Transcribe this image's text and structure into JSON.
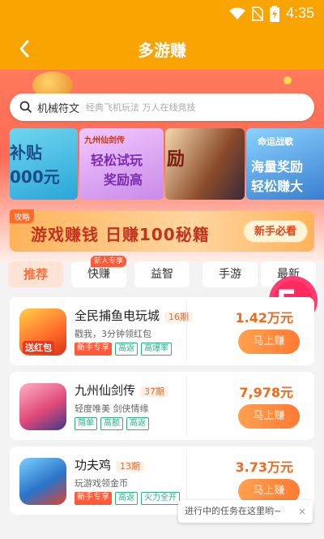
{
  "status": {
    "time": "4:35"
  },
  "header": {
    "title": "多游赚"
  },
  "search": {
    "value": "机械符文",
    "placeholder": "经典飞机玩法 万人在线竞技"
  },
  "banners": [
    {
      "lines": [
        "补贴",
        "000元"
      ]
    },
    {
      "logo": "九州仙剑传",
      "lines": [
        "轻松试玩",
        "奖励高"
      ]
    },
    {
      "lines": [
        "励"
      ]
    },
    {
      "logo": "命运战歌",
      "lines": [
        "海量奖励",
        "轻松赚大"
      ]
    }
  ],
  "promo": {
    "tag": "攻略",
    "title": "游戏赚钱 日赚100秘籍",
    "button": "新手必看"
  },
  "tabs": [
    {
      "label": "推荐",
      "active": true
    },
    {
      "label": "快赚",
      "badge": "新人专享"
    },
    {
      "label": "益智"
    },
    {
      "label": "手游"
    },
    {
      "label": "最新"
    }
  ],
  "float_badge": {
    "text": "5",
    "unit": "元"
  },
  "games": [
    {
      "name": "全民捕鱼电玩城",
      "period": "16期",
      "desc": "戳我，3分钟领红包",
      "tags": [
        {
          "text": "新手专享",
          "style": "red"
        },
        {
          "text": "高返",
          "style": "green"
        },
        {
          "text": "高爆率",
          "style": "green"
        }
      ],
      "reward": "1.42万元",
      "button": "马上赚",
      "icon_label": "送红包"
    },
    {
      "name": "九州仙剑传",
      "period": "37期",
      "desc": "轻度唯美 剑侠情缘",
      "tags": [
        {
          "text": "简单",
          "style": "green"
        },
        {
          "text": "高额",
          "style": "green"
        },
        {
          "text": "高返",
          "style": "green"
        }
      ],
      "reward": "7,978元",
      "button": "马上赚"
    },
    {
      "name": "功夫鸡",
      "period": "13期",
      "desc": "玩游戏领金币",
      "tags": [
        {
          "text": "新手专享",
          "style": "red"
        },
        {
          "text": "高返",
          "style": "green"
        },
        {
          "text": "火力全开",
          "style": "green"
        }
      ],
      "reward": "3.73万元",
      "button": "马上赚"
    }
  ],
  "toast": {
    "text": "进行中的任务在这里哟~",
    "close": "×"
  },
  "colors": {
    "brand": "#f9a400",
    "accent": "#ff7a33"
  }
}
